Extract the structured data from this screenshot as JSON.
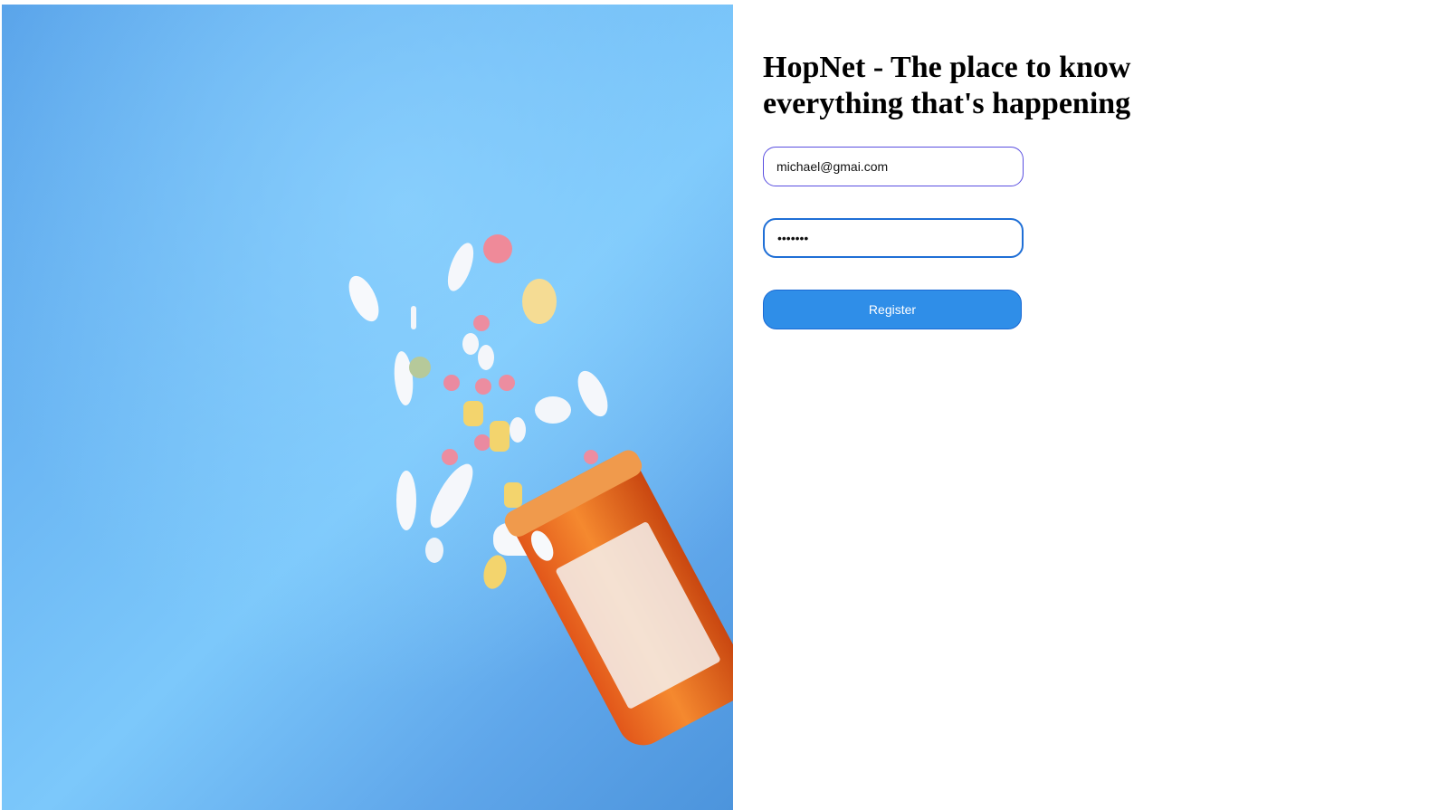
{
  "login": {
    "title": "HopNet - The place to know everything that's happening",
    "email_value": "michael@gmai.com",
    "password_value": "•••••••",
    "register_label": "Register"
  },
  "hero_image": {
    "subject": "spilled-pills-and-orange-bottle"
  },
  "colors": {
    "accent": "#2f8ee8",
    "email_border": "#5a4fe0",
    "password_border": "#1f6fd6",
    "hero_background": "#6bb6f3"
  }
}
